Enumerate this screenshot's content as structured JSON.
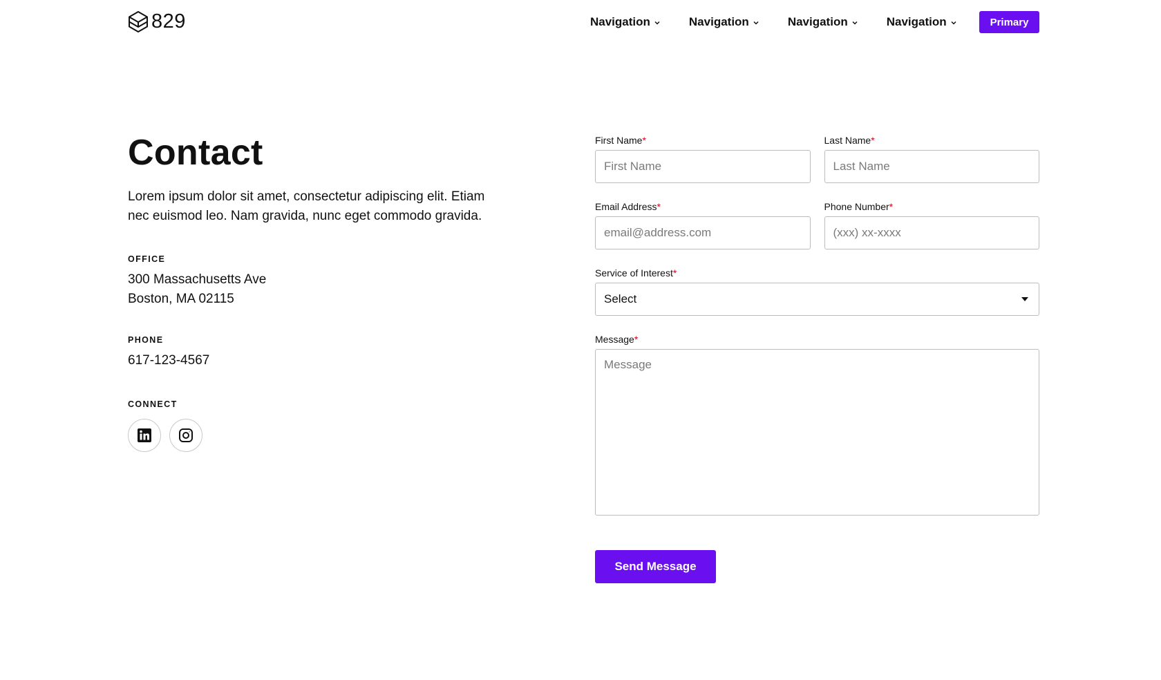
{
  "header": {
    "logo_text": "829",
    "logo_icon": "hexagon-stack-icon",
    "nav": [
      {
        "label": "Navigation"
      },
      {
        "label": "Navigation"
      },
      {
        "label": "Navigation"
      },
      {
        "label": "Navigation"
      }
    ],
    "primary_label": "Primary",
    "accent_color": "#6a0ff0"
  },
  "contact": {
    "title": "Contact",
    "intro": "Lorem ipsum dolor sit amet, consectetur adipiscing elit. Etiam nec euismod leo. Nam gravida, nunc eget commodo gravida.",
    "office": {
      "label": "OFFICE",
      "line1": "300 Massachusetts Ave",
      "line2": "Boston, MA 02115"
    },
    "phone": {
      "label": "PHONE",
      "value": "617-123-4567"
    },
    "connect": {
      "label": "CONNECT",
      "icons": [
        "linkedin-icon",
        "instagram-icon"
      ]
    }
  },
  "form": {
    "required_marker": "*",
    "first_name": {
      "label": "First Name",
      "placeholder": "First Name"
    },
    "last_name": {
      "label": "Last Name",
      "placeholder": "Last Name"
    },
    "email": {
      "label": "Email Address",
      "placeholder": "email@address.com"
    },
    "phone": {
      "label": "Phone Number",
      "placeholder": "(xxx) xx-xxxx"
    },
    "service": {
      "label": "Service of Interest",
      "selected": "Select"
    },
    "message": {
      "label": "Message",
      "placeholder": "Message"
    },
    "submit_label": "Send Message"
  }
}
